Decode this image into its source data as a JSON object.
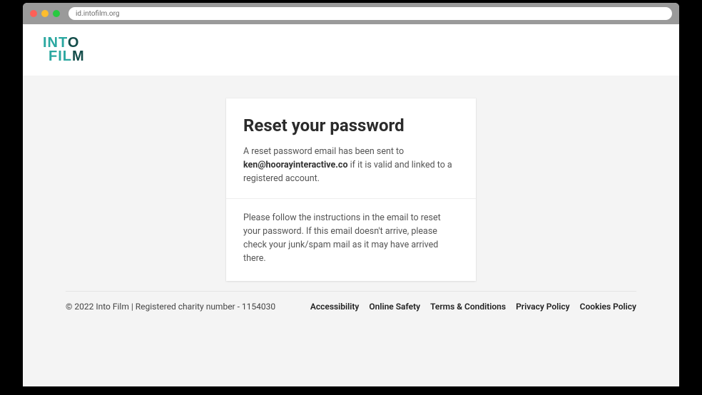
{
  "browser": {
    "url": "id.intofilm.org"
  },
  "logo": {
    "line1a": "INT",
    "line1b": "O",
    "line2a": "FIL",
    "line2b": "M"
  },
  "card": {
    "heading": "Reset your password",
    "message_pre": "A reset password email has been sent to ",
    "email": "ken@hoorayinteractive.co",
    "message_post": " if it is valid and linked to a registered account.",
    "instructions": "Please follow the instructions in the email to reset your password. If this email doesn't arrive, please check your junk/spam mail as it may have arrived there."
  },
  "footer": {
    "copyright": "© 2022 Into Film | Registered charity number - 1154030",
    "links": [
      "Accessibility",
      "Online Safety",
      "Terms & Conditions",
      "Privacy Policy",
      "Cookies Policy"
    ]
  }
}
